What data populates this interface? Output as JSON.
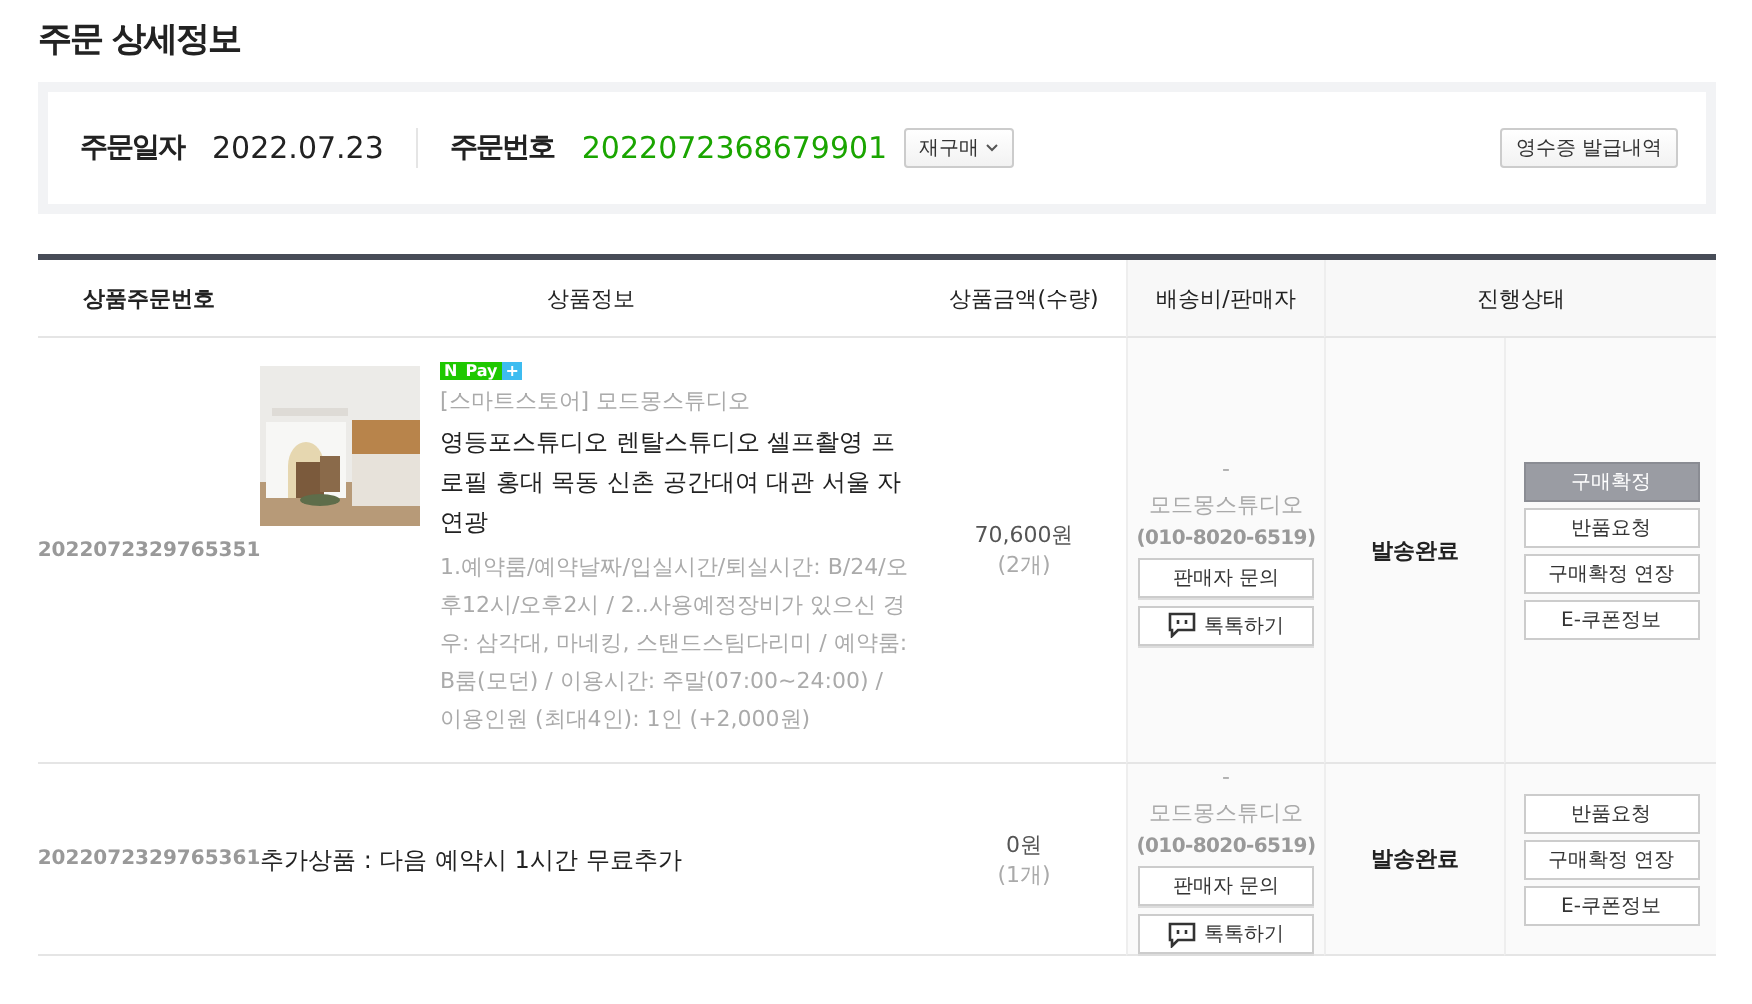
{
  "title": "주문 상세정보",
  "summary": {
    "date_label": "주문일자",
    "date": "2022.07.23",
    "order_label": "주문번호",
    "order_no": "2022072368679901",
    "reorder_button": "재구매",
    "receipt_button": "영수증 발급내역"
  },
  "table": {
    "columns": [
      "상품주문번호",
      "상품정보",
      "상품금액(수량)",
      "배송비/판매자",
      "진행상태"
    ],
    "rows": [
      {
        "order_no": "2022072329765351",
        "image": {
          "kind": "picture"
        },
        "badge": {
          "n": "N",
          "pay": "Pay",
          "plus": "+"
        },
        "store": "[스마트스토어] 모드몽스튜디오",
        "name": "영등포스튜디오 렌탈스튜디오 셀프촬영 프로필 홍대 목동 신촌 공간대여 대관 서울 자연광",
        "options": "1.예약룸/예약날짜/입실시간/퇴실시간: B/24/오후12시/오후2시 / 2..사용예정장비가 있으신 경우: 삼각대, 마네킹, 스탠드스팀다리미 / 예약룸: B룸(모던) / 이용시간: 주말(07:00~24:00) / 이용인원 (최대4인): 1인 (+2,000원)",
        "price": "70,600원",
        "qty": "(2개)",
        "shipping": "-",
        "seller": "모드몽스튜디오",
        "phone": "(010-8020-6519)",
        "seller_buttons": [
          "판매자 문의",
          "톡톡하기"
        ],
        "status": "발송완료",
        "actions": [
          {
            "label": "구매확정",
            "kind": "primary"
          },
          {
            "label": "반품요청",
            "kind": "normal"
          },
          {
            "label": "구매확정 연장",
            "kind": "normal"
          },
          {
            "label": "E-쿠폰정보",
            "kind": "normal"
          }
        ]
      },
      {
        "order_no": "2022072329765361",
        "name": "추가상품 : 다음 예약시 1시간 무료추가",
        "price": "0원",
        "qty": "(1개)",
        "shipping": "-",
        "seller": "모드몽스튜디오",
        "phone": "(010-8020-6519)",
        "seller_buttons": [
          "판매자 문의",
          "톡톡하기"
        ],
        "status": "발송완료",
        "actions": [
          {
            "label": "반품요청",
            "kind": "normal"
          },
          {
            "label": "구매확정 연장",
            "kind": "normal"
          },
          {
            "label": "E-쿠폰정보",
            "kind": "normal"
          }
        ]
      }
    ]
  }
}
